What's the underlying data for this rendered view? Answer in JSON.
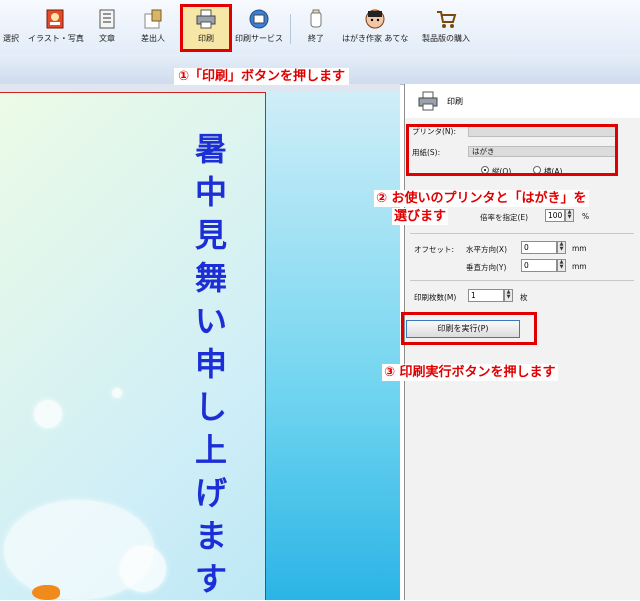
{
  "toolbar": {
    "items": [
      {
        "label": "選択",
        "icon": "select-icon"
      },
      {
        "label": "イラスト・写真",
        "icon": "illustration-photo-icon"
      },
      {
        "label": "文章",
        "icon": "text-icon"
      },
      {
        "label": "差出人",
        "icon": "sender-icon"
      },
      {
        "label": "印刷",
        "icon": "printer-icon"
      },
      {
        "label": "印刷サービス",
        "icon": "print-service-icon"
      },
      {
        "label": "終了",
        "icon": "exit-icon"
      },
      {
        "label": "はがき作家 あてな",
        "icon": "address-app-icon"
      },
      {
        "label": "製品版の購入",
        "icon": "shopping-cart-icon"
      }
    ],
    "active": "印刷"
  },
  "card": {
    "greeting": [
      "暑",
      "中",
      "見",
      "舞",
      "い",
      "申",
      "し",
      "上",
      "げ",
      "ま",
      "す"
    ],
    "text_color": "#1c2fd6"
  },
  "panel": {
    "title": "印刷",
    "printer_label": "プリンタ(N):",
    "printer_value": "",
    "paper_label": "用紙(S):",
    "paper_value": "はがき",
    "orientation": {
      "portrait": "縦(O)",
      "landscape": "横(A)",
      "selected": "portrait"
    },
    "scale_label": "倍率を指定(E)",
    "scale_value": "100",
    "scale_unit": "%",
    "offset_label": "オフセット:",
    "h_offset_label": "水平方向(X)",
    "h_offset_value": "0",
    "v_offset_label": "垂直方向(Y)",
    "v_offset_value": "0",
    "offset_unit": "mm",
    "copies_label": "印刷枚数(M)",
    "copies_value": "1",
    "copies_unit": "枚",
    "execute_button": "印刷を実行(P)"
  },
  "annotations": {
    "step1": "①「印刷」ボタンを押します",
    "step2_line1": "② お使いのプリンタと「はがき」を",
    "step2_line2": "選びます",
    "step3": "③ 印刷実行ボタンを押します",
    "color": "#e00000"
  }
}
